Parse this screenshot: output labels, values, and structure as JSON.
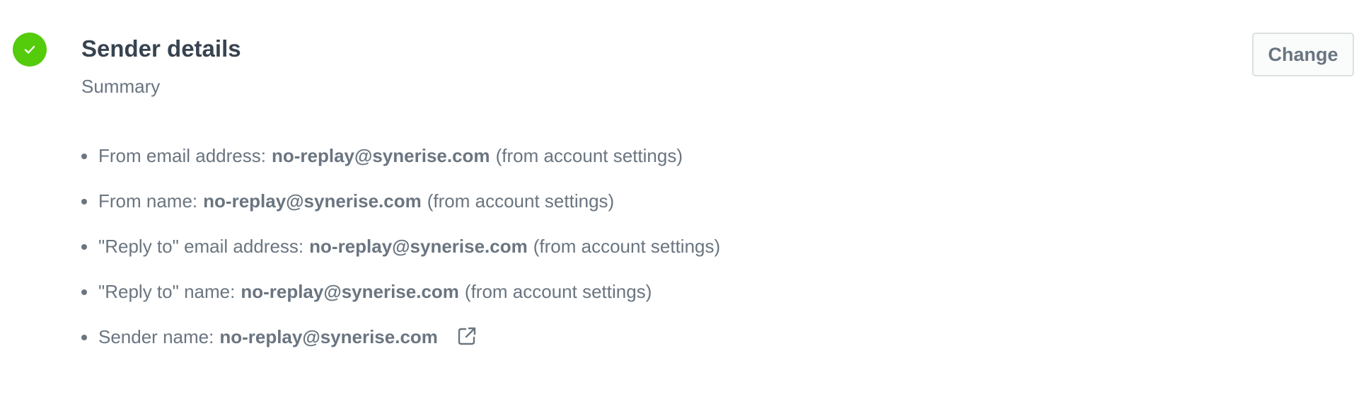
{
  "section": {
    "title": "Sender details",
    "subtitle": "Summary",
    "status_icon": "check-icon",
    "status_color": "#54cb0b",
    "change_label": "Change"
  },
  "summary": {
    "items": [
      {
        "label": "From email address:",
        "value": "no-replay@synerise.com",
        "note": "(from account settings)"
      },
      {
        "label": "From name:",
        "value": "no-replay@synerise.com",
        "note": "(from account settings)"
      },
      {
        "label": "\"Reply to\" email address:",
        "value": "no-replay@synerise.com",
        "note": "(from account settings)"
      },
      {
        "label": "\"Reply to\" name:",
        "value": "no-replay@synerise.com",
        "note": "(from account settings)"
      },
      {
        "label": "Sender name:",
        "value": "no-replay@synerise.com",
        "link_icon": "external-link-icon"
      }
    ]
  },
  "colors": {
    "text_primary": "#384350",
    "text_secondary": "#6a7580",
    "success": "#54cb0b",
    "button_border": "#dbe0e3"
  }
}
